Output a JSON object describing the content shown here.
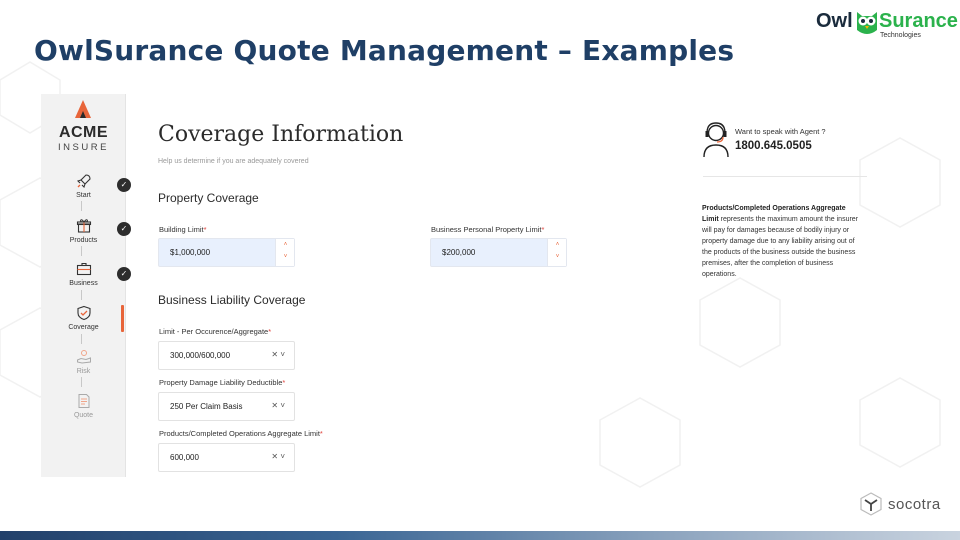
{
  "slide": {
    "title": "OwlSurance Quote Management  – Examples",
    "brand": {
      "word_a": "Owl",
      "word_b": "Surance",
      "sub": "Technologies"
    }
  },
  "sidebar": {
    "logo": {
      "name": "ACME",
      "sub": "INSURE"
    },
    "steps": [
      {
        "label": "Start",
        "icon": "rocket-icon",
        "completed": true
      },
      {
        "label": "Products",
        "icon": "gift-box-icon",
        "completed": true
      },
      {
        "label": "Business",
        "icon": "briefcase-icon",
        "completed": true
      },
      {
        "label": "Coverage",
        "icon": "shield-check-icon",
        "active": true
      },
      {
        "label": "Risk",
        "icon": "hand-coin-icon",
        "disabled": true
      },
      {
        "label": "Quote",
        "icon": "document-icon",
        "disabled": true
      }
    ],
    "check_glyph": "✓"
  },
  "form": {
    "title": "Coverage Information",
    "subtitle": "Help us determine if you are adequately covered",
    "property": {
      "heading": "Property Coverage",
      "building_limit": {
        "label": "Building Limit",
        "value": "$1,000,000"
      },
      "bpp_limit": {
        "label": "Business Personal Property Limit",
        "value": "$200,000"
      }
    },
    "liability": {
      "heading": "Business Liability Coverage",
      "per_occurrence": {
        "label": "Limit - Per Occurence/Aggregate",
        "value": "300,000/600,000"
      },
      "pd_deductible": {
        "label": "Property Damage Liability Deductible",
        "value": "250 Per Claim Basis"
      },
      "products_limit": {
        "label": "Products/Completed Operations Aggregate Limit",
        "value": "600,000"
      }
    },
    "required_mark": "*",
    "spin_up": "˄",
    "spin_down": "˅",
    "select_ctrl": "✕ ˅"
  },
  "agent": {
    "question": "Want to speak with Agent ?",
    "phone": "1800.645.0505"
  },
  "help": {
    "term": "Products/Completed Operations Aggregate Limit",
    "text": " represents the maximum amount the insurer will pay for damages because of bodily injury or property damage due to any liability arising out of the products of the business outside the business premises, after the completion of business operations."
  },
  "footer": {
    "brand": "socotra"
  },
  "colors": {
    "title": "#1f3f66",
    "accent": "#e8653a",
    "owl_green": "#2bb24c",
    "input_fill": "#e8f0fd"
  }
}
